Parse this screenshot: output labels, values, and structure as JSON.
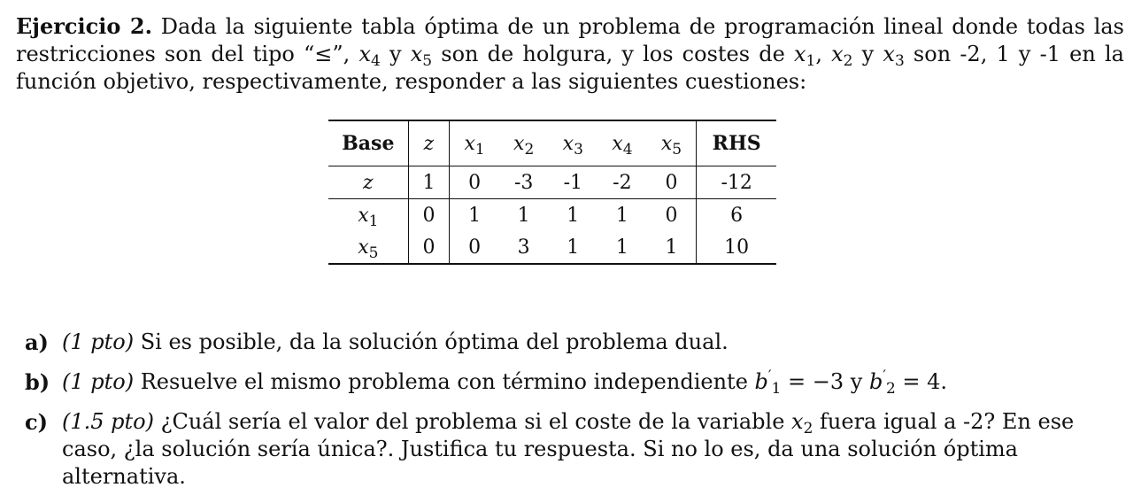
{
  "intro": {
    "label": "Ejercicio 2.",
    "t1": " Dada la siguiente tabla óptima de un problema de programación lineal donde todas las restricciones son del tipo “≤”, ",
    "t2": " y ",
    "t3": " son de holgura, y los costes de ",
    "t4": ", ",
    "t5": " y ",
    "t6": " son -2, 1 y -1 en la función objetivo, respectivamente, responder a las siguientes cuestiones:"
  },
  "table": {
    "header": {
      "base": "Base",
      "z": "z",
      "vars": [
        "1",
        "2",
        "3",
        "4",
        "5"
      ],
      "rhs": "RHS"
    },
    "z_row": {
      "base": "z",
      "z": "1",
      "values": [
        "0",
        "-3",
        "-1",
        "-2",
        "0"
      ],
      "rhs": "-12"
    },
    "rows": [
      {
        "base_index": "1",
        "z": "0",
        "values": [
          "1",
          "1",
          "1",
          "1",
          "0"
        ],
        "rhs": "6"
      },
      {
        "base_index": "5",
        "z": "0",
        "values": [
          "0",
          "3",
          "1",
          "1",
          "1"
        ],
        "rhs": "10"
      }
    ]
  },
  "questions": {
    "a": {
      "letter": "a)",
      "points": "(1 pto)",
      "text": " Si es posible, da la solución óptima del problema dual."
    },
    "b": {
      "letter": "b)",
      "points": "(1 pto)",
      "text1": " Resuelve el mismo problema con término independiente ",
      "text2": " = −3 y ",
      "text3": " = 4."
    },
    "c": {
      "letter": "c)",
      "points": "(1.5 pto)",
      "text1": " ¿Cuál sería el valor del problema si el coste de la variable ",
      "text2": " fuera igual a -2? En ese caso, ¿la solución sería única?. Justifica tu respuesta. Si no lo es, da una solución óptima alternativa."
    }
  }
}
